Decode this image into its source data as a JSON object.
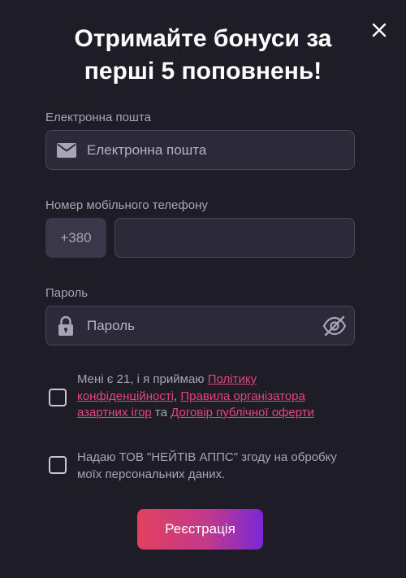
{
  "modal": {
    "title_line1": "Отримайте бонуси за",
    "title_line2": "перші 5 поповнень!",
    "close_icon": "close-icon"
  },
  "email": {
    "label": "Електронна пошта",
    "placeholder": "Електронна пошта",
    "icon": "mail-icon"
  },
  "phone": {
    "label": "Номер мобільного телефону",
    "prefix": "+380",
    "value": ""
  },
  "password": {
    "label": "Пароль",
    "placeholder": "Пароль",
    "icon": "lock-icon",
    "toggle_icon": "eye-off-icon"
  },
  "consents": [
    {
      "text_prefix": "Мені є 21, і я приймаю ",
      "link1": "Політику конфіденційності",
      "sep1": ", ",
      "link2": "Правила організатора азартних ігор",
      "sep2": " та ",
      "link3": "Договір публічної оферти",
      "checked": false
    },
    {
      "text": "Надаю ТОВ \"НЕЙТІВ АППС\" згоду на обробку моїх персональних даних.",
      "checked": false
    }
  ],
  "submit": {
    "label": "Реєстрація"
  },
  "colors": {
    "background": "#1e1c27",
    "field_bg": "#2c2a39",
    "link": "#e2467c",
    "button_gradient_start": "#e3405f",
    "button_gradient_end": "#7a27d6"
  }
}
